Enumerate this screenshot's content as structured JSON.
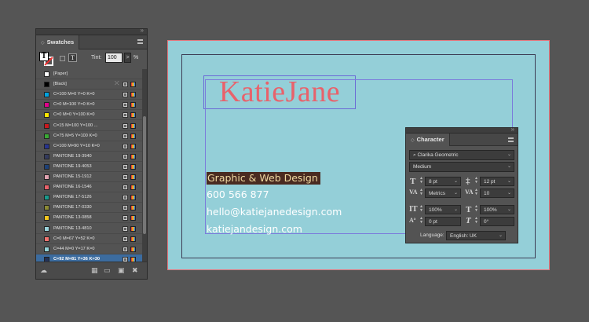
{
  "swatches_panel": {
    "tab_label": "Swatches",
    "tint_label": "Tint:",
    "tint_value": "100",
    "tint_arrow": ">",
    "tint_unit": "%",
    "fill_glyph": "T",
    "text_glyph": "T",
    "items": [
      {
        "name": "[Paper]",
        "color": "#ffffff",
        "lock": false,
        "icons": false,
        "selected": false
      },
      {
        "name": "[Black]",
        "color": "#000000",
        "lock": true,
        "icons": true,
        "selected": false
      },
      {
        "name": "C=100 M=0 Y=0 K=0",
        "color": "#00a3e0",
        "lock": false,
        "icons": true,
        "selected": false
      },
      {
        "name": "C=0 M=100 Y=0 K=0",
        "color": "#e3008c",
        "lock": false,
        "icons": true,
        "selected": false
      },
      {
        "name": "C=0 M=0 Y=100 K=0",
        "color": "#ffe600",
        "lock": false,
        "icons": true,
        "selected": false
      },
      {
        "name": "C=15 M=100 Y=100 ...",
        "color": "#c8191f",
        "lock": false,
        "icons": true,
        "selected": false
      },
      {
        "name": "C=75 M=5 Y=100 K=0",
        "color": "#3aa935",
        "lock": false,
        "icons": true,
        "selected": false
      },
      {
        "name": "C=100 M=90 Y=10 K=0",
        "color": "#28358e",
        "lock": false,
        "icons": true,
        "selected": false
      },
      {
        "name": "PANTONE 19-3940",
        "color": "#343b5e",
        "lock": false,
        "icons": true,
        "selected": false
      },
      {
        "name": "PANTONE 19-4053",
        "color": "#1e4177",
        "lock": false,
        "icons": true,
        "selected": false
      },
      {
        "name": "PANTONE 15-1912",
        "color": "#e0a2b0",
        "lock": false,
        "icons": true,
        "selected": false
      },
      {
        "name": "PANTONE 16-1546",
        "color": "#e9626a",
        "lock": false,
        "icons": true,
        "selected": false
      },
      {
        "name": "PANTONE 17-5126",
        "color": "#1a9a8c",
        "lock": false,
        "icons": true,
        "selected": false
      },
      {
        "name": "PANTONE 17-0330",
        "color": "#8c8a35",
        "lock": false,
        "icons": true,
        "selected": false
      },
      {
        "name": "PANTONE 13-0858",
        "color": "#f4c61f",
        "lock": false,
        "icons": true,
        "selected": false
      },
      {
        "name": "PANTONE 13-4810",
        "color": "#9ad4dc",
        "lock": false,
        "icons": true,
        "selected": false
      },
      {
        "name": "C=0 M=67 Y=52 K=0",
        "color": "#f0736f",
        "lock": false,
        "icons": true,
        "selected": false
      },
      {
        "name": "C=44 M=0 Y=17 K=0",
        "color": "#92d1d6",
        "lock": false,
        "icons": true,
        "selected": false
      },
      {
        "name": "C=92 M=81 Y=36 K=30",
        "color": "#233256",
        "lock": false,
        "icons": true,
        "selected": true
      }
    ]
  },
  "document": {
    "logo_text": "KatieJane",
    "lines": [
      "Graphic & Web Design",
      "600 566 877",
      "hello@katiejanedesign.com",
      "katiejandesign.com"
    ]
  },
  "character_panel": {
    "tab_label": "Character",
    "font_family": "Clarika Geometric",
    "font_style": "Medium",
    "font_size": "8 pt",
    "leading": "12 pt",
    "kerning": "Metrics",
    "tracking": "10",
    "vertical_scale": "100%",
    "horizontal_scale": "100%",
    "baseline_shift": "0 pt",
    "skew": "0°",
    "language_label": "Language:",
    "language_value": "English: UK"
  },
  "colors": {
    "app_bg": "#555555",
    "panel_bg": "#535353",
    "page_bg": "#94cfd8",
    "logo": "#e8626b",
    "selection_highlight": "#4a2b21",
    "selection_text": "#f0d9a1",
    "selected_row": "#3c6c9f"
  }
}
